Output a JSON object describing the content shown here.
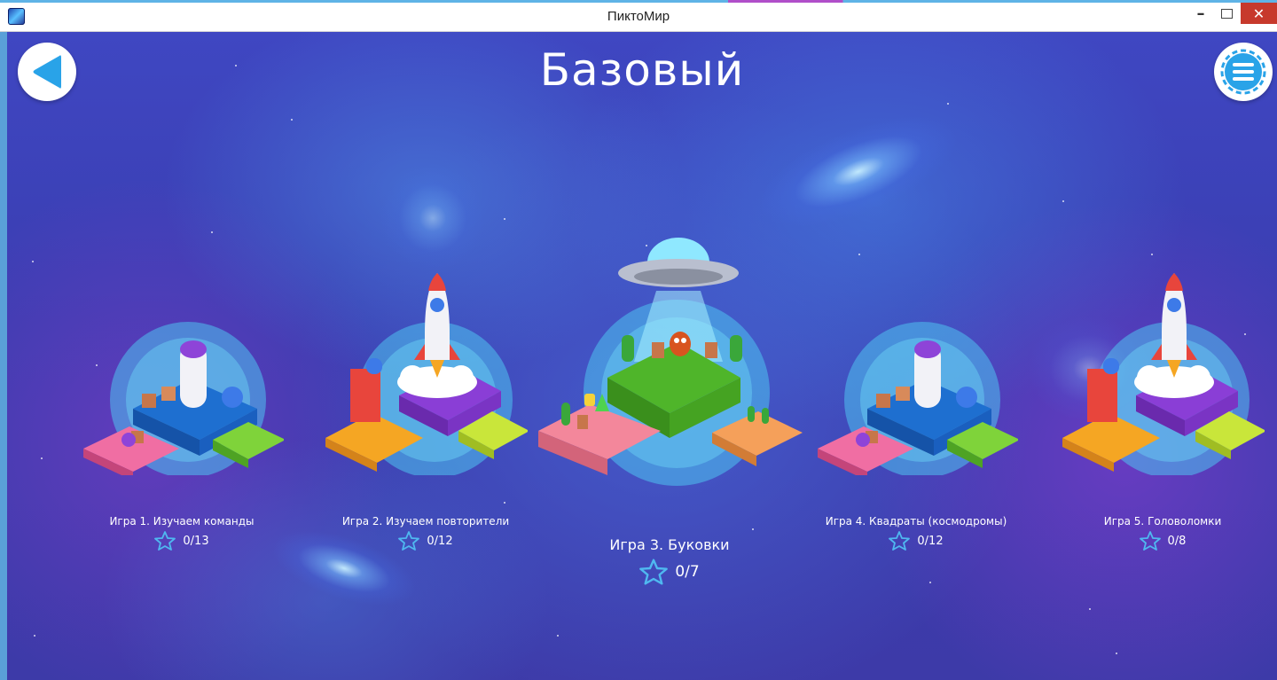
{
  "window": {
    "title": "ПиктоМир",
    "minimize_glyph": "–",
    "close_glyph": "✕",
    "icon": "app-pictomir-icon"
  },
  "header": {
    "title": "Базовый",
    "back_icon": "back-triangle-icon",
    "menu_icon": "menu-hamburger-icon"
  },
  "colors": {
    "background": "#3b3fb0",
    "accent_blue": "#29a3e8",
    "star_outline": "#4fb8f0",
    "close_red": "#c7392c"
  },
  "games": [
    {
      "label": "Игра 1. Изучаем команды",
      "score": "0/13",
      "art": "robot-base-platform"
    },
    {
      "label": "Игра 2. Изучаем повторители",
      "score": "0/12",
      "art": "rocket-launch-platform"
    },
    {
      "label": "Игра 3. Буковки",
      "score": "0/7",
      "art": "ufo-garden-platform"
    },
    {
      "label": "Игра 4. Квадраты (космодромы)",
      "score": "0/12",
      "art": "robot-base-platform"
    },
    {
      "label": "Игра 5. Головоломки",
      "score": "0/8",
      "art": "rocket-launch-platform"
    }
  ]
}
